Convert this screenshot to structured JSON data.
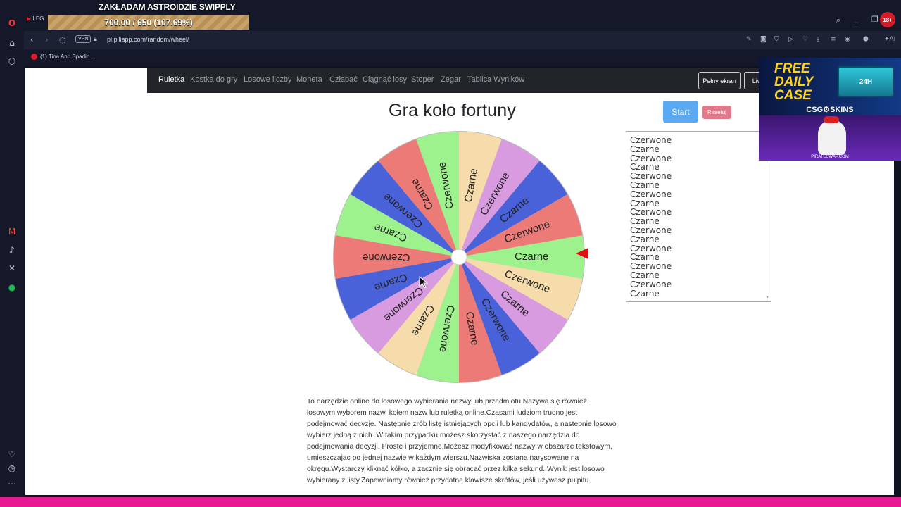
{
  "stream": {
    "title": "ZAKŁADAM ASTROIDZIE SWIPPLY",
    "progress_text": "700.00 / 650 (107.69%)",
    "progress_percent": 107.69
  },
  "browser": {
    "tab_label": "LEG",
    "url": "pl.piliapp.com/random/wheel/",
    "vpn_label": "VPN",
    "bookmark": "(1) Tina And Spadin...",
    "age_badge": "18+",
    "ai_label": "AI"
  },
  "nav": {
    "links": [
      "Ruletka",
      "Kostka do gry",
      "Losowe liczby",
      "Moneta",
      "Człapać",
      "Ciągnąć losy",
      "Stoper",
      "Zegar",
      "Tablica Wyników"
    ],
    "fullscreen": "Pełny ekran",
    "live": "Live"
  },
  "page": {
    "title": "Gra koło fortuny",
    "start": "Start",
    "reset": "Resetuj",
    "description": "To narzędzie online do losowego wybierania nazwy lub przedmiotu.Nazywa się również losowym wyborem nazw, kołem nazw lub ruletką online.Czasami ludziom trudno jest podejmować decyzje. Następnie zrób listę istniejących opcji lub kandydatów, a następnie losowo wybierz jedną z nich. W takim przypadku możesz skorzystać z naszego narzędzia do podejmowania decyzji. Proste i przyjemne.Możesz modyfikować nazwy w obszarze tekstowym, umieszczając po jednej nazwie w każdym wierszu.Nazwiska zostaną narysowane na okręgu.Wystarczy kliknąć kółko, a zacznie się obracać przez kilka sekund. Wynik jest losowo wybierany z listy.Zapewniamy również przydatne klawisze skrótów, jeśli używasz pulpitu."
  },
  "names": [
    "Czerwone",
    "Czarne",
    "Czerwone",
    "Czarne",
    "Czerwone",
    "Czarne",
    "Czerwone",
    "Czarne",
    "Czerwone",
    "Czarne",
    "Czerwone",
    "Czarne",
    "Czerwone",
    "Czarne",
    "Czerwone",
    "Czarne",
    "Czerwone",
    "Czarne"
  ],
  "wheel": {
    "segments": [
      {
        "label": "Czarne",
        "color": "#9ef28e"
      },
      {
        "label": "Czerwone",
        "color": "#f5dcaa"
      },
      {
        "label": "Czarne",
        "color": "#d89be0"
      },
      {
        "label": "Czerwone",
        "color": "#4a62d9"
      },
      {
        "label": "Czarne",
        "color": "#ec7b78"
      },
      {
        "label": "Czerwone",
        "color": "#9ef28e"
      },
      {
        "label": "Czarne",
        "color": "#f5dcaa"
      },
      {
        "label": "Czerwone",
        "color": "#d89be0"
      },
      {
        "label": "Czarne",
        "color": "#4a62d9"
      },
      {
        "label": "Czerwone",
        "color": "#ec7b78"
      },
      {
        "label": "Czarne",
        "color": "#9ef28e"
      },
      {
        "label": "Czerwone",
        "color": "#4a62d9"
      },
      {
        "label": "Czarne",
        "color": "#ec7b78"
      },
      {
        "label": "Czerwone",
        "color": "#9ef28e"
      },
      {
        "label": "Czarne",
        "color": "#f5dcaa"
      },
      {
        "label": "Czerwone",
        "color": "#d89be0"
      },
      {
        "label": "Czarne",
        "color": "#4a62d9"
      },
      {
        "label": "Czerwone",
        "color": "#ec7b78"
      }
    ],
    "pointer_color": "#e01010"
  },
  "ad": {
    "headline": "FREE DAILY CASE",
    "brand": "CSG⚙SKINS",
    "box_text": "24H",
    "footer": "PIRATESWAP.COM"
  },
  "icons": {
    "back": "back-arrow-icon",
    "forward": "forward-arrow-icon",
    "reload": "reload-icon",
    "lock": "lock-icon",
    "cursor": "mouse-cursor-icon"
  }
}
